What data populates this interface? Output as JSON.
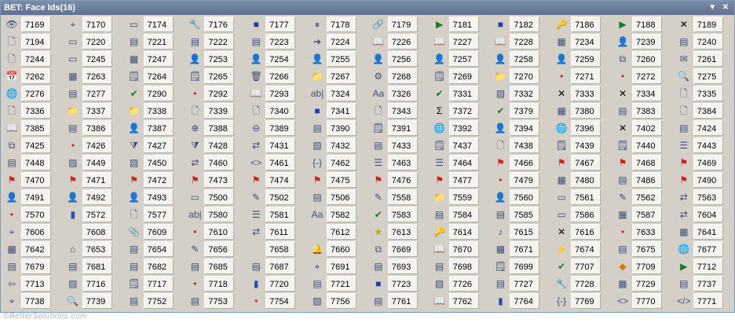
{
  "window": {
    "title": "BET: Face Ids(16)"
  },
  "footer_text": "©BetterSolutions.com",
  "icon_glyphs": {
    "eye": "👁",
    "crop": "⌖",
    "rect": "▭",
    "wrench": "🔧",
    "square": "■",
    "pause": "⏸",
    "link": "🔗",
    "play": "▶",
    "stop": "■",
    "key": "🔑",
    "grid": "▦",
    "xmark": "✕",
    "page": "🗋",
    "form": "▤",
    "book": "📖",
    "arrow": "➔",
    "person": "👤",
    "mail": "✉",
    "table": "▦",
    "cal": "📅",
    "note": "🗒",
    "trash": "🗑",
    "folder": "📁",
    "dot": "•",
    "search": "🔍",
    "globe": "🌐",
    "check": "✔",
    "sigma": "Σ",
    "zoomin": "⊕",
    "zoomout": "⊖",
    "flag": "⚑",
    "bell": "🔔",
    "pencil": "✎",
    "arrows": "⇄",
    "home": "⌂",
    "aa": "Aa",
    "abl": "ab|",
    "sound": "♪",
    "lightning": "⚡",
    "lt": "⇦",
    "code": "<>",
    "endcode": "</>",
    "brace": "{-}",
    "chart": "▮",
    "clip": "📎",
    "star": "★",
    "diamond": "◆",
    "image": "▨",
    "funnel": "⧩",
    "gear": "⚙",
    "lines": "☰",
    "copy": "⧉",
    "x": "✕",
    "blank": " "
  },
  "rows": [
    [
      [
        "eye",
        "7169"
      ],
      [
        "crop",
        "7170"
      ],
      [
        "rect",
        "7174"
      ],
      [
        "wrench",
        "7176"
      ],
      [
        "square",
        "7177"
      ],
      [
        "pause",
        "7178"
      ],
      [
        "link",
        "7179"
      ],
      [
        "play",
        "7181"
      ],
      [
        "stop",
        "7182"
      ],
      [
        "key",
        "7186"
      ],
      [
        "play",
        "7188"
      ],
      [
        "xmark",
        "7189"
      ]
    ],
    [
      [
        "page",
        "7194"
      ],
      [
        "rect",
        "7220"
      ],
      [
        "form",
        "7221"
      ],
      [
        "form",
        "7222"
      ],
      [
        "form",
        "7223"
      ],
      [
        "arrow",
        "7224"
      ],
      [
        "book",
        "7226"
      ],
      [
        "book",
        "7227"
      ],
      [
        "book",
        "7228"
      ],
      [
        "table",
        "7234"
      ],
      [
        "person",
        "7239"
      ],
      [
        "form",
        "7240"
      ]
    ],
    [
      [
        "page",
        "7244"
      ],
      [
        "rect",
        "7245"
      ],
      [
        "table",
        "7247"
      ],
      [
        "person",
        "7253"
      ],
      [
        "person",
        "7254"
      ],
      [
        "person",
        "7255"
      ],
      [
        "person",
        "7256"
      ],
      [
        "person",
        "7257"
      ],
      [
        "person",
        "7258"
      ],
      [
        "person",
        "7259"
      ],
      [
        "copy",
        "7260"
      ],
      [
        "mail",
        "7261"
      ]
    ],
    [
      [
        "cal",
        "7262"
      ],
      [
        "table",
        "7263"
      ],
      [
        "note",
        "7264"
      ],
      [
        "note",
        "7265"
      ],
      [
        "trash",
        "7266"
      ],
      [
        "folder",
        "7267"
      ],
      [
        "gear",
        "7268"
      ],
      [
        "note",
        "7269"
      ],
      [
        "folder",
        "7270"
      ],
      [
        "dot",
        "7271"
      ],
      [
        "dot",
        "7272"
      ],
      [
        "search",
        "7275"
      ]
    ],
    [
      [
        "globe",
        "7276"
      ],
      [
        "form",
        "7277"
      ],
      [
        "check",
        "7290"
      ],
      [
        "dot",
        "7292"
      ],
      [
        "book",
        "7293"
      ],
      [
        "abl",
        "7324"
      ],
      [
        "aa",
        "7326"
      ],
      [
        "check",
        "7331"
      ],
      [
        "image",
        "7332"
      ],
      [
        "x",
        "7333"
      ],
      [
        "x",
        "7334"
      ],
      [
        "page",
        "7335"
      ]
    ],
    [
      [
        "page",
        "7336"
      ],
      [
        "folder",
        "7337"
      ],
      [
        "folder",
        "7338"
      ],
      [
        "page",
        "7339"
      ],
      [
        "page",
        "7340"
      ],
      [
        "square",
        "7341"
      ],
      [
        "page",
        "7343"
      ],
      [
        "sigma",
        "7372"
      ],
      [
        "check",
        "7379"
      ],
      [
        "table",
        "7380"
      ],
      [
        "form",
        "7383"
      ],
      [
        "page",
        "7384"
      ]
    ],
    [
      [
        "book",
        "7385"
      ],
      [
        "form",
        "7386"
      ],
      [
        "person",
        "7387"
      ],
      [
        "zoomin",
        "7388"
      ],
      [
        "zoomout",
        "7389"
      ],
      [
        "form",
        "7390"
      ],
      [
        "note",
        "7391"
      ],
      [
        "globe",
        "7392"
      ],
      [
        "person",
        "7394"
      ],
      [
        "globe",
        "7396"
      ],
      [
        "x",
        "7402"
      ],
      [
        "form",
        "7424"
      ]
    ],
    [
      [
        "copy",
        "7425"
      ],
      [
        "dot",
        "7426"
      ],
      [
        "funnel",
        "7427"
      ],
      [
        "funnel",
        "7428"
      ],
      [
        "arrows",
        "7431"
      ],
      [
        "image",
        "7432"
      ],
      [
        "form",
        "7433"
      ],
      [
        "note",
        "7437"
      ],
      [
        "page",
        "7438"
      ],
      [
        "note",
        "7439"
      ],
      [
        "note",
        "7440"
      ],
      [
        "lines",
        "7443"
      ]
    ],
    [
      [
        "form",
        "7448"
      ],
      [
        "image",
        "7449"
      ],
      [
        "image",
        "7450"
      ],
      [
        "arrows",
        "7460"
      ],
      [
        "code",
        "7461"
      ],
      [
        "brace",
        "7462"
      ],
      [
        "lines",
        "7463"
      ],
      [
        "lines",
        "7464"
      ],
      [
        "flag",
        "7466"
      ],
      [
        "flag",
        "7467"
      ],
      [
        "flag",
        "7468"
      ],
      [
        "flag",
        "7469"
      ]
    ],
    [
      [
        "flag",
        "7470"
      ],
      [
        "flag",
        "7471"
      ],
      [
        "flag",
        "7472"
      ],
      [
        "flag",
        "7473"
      ],
      [
        "flag",
        "7474"
      ],
      [
        "flag",
        "7475"
      ],
      [
        "flag",
        "7476"
      ],
      [
        "flag",
        "7477"
      ],
      [
        "dot",
        "7479"
      ],
      [
        "table",
        "7480"
      ],
      [
        "form",
        "7486"
      ],
      [
        "flag",
        "7490"
      ]
    ],
    [
      [
        "person",
        "7491"
      ],
      [
        "person",
        "7492"
      ],
      [
        "person",
        "7493"
      ],
      [
        "rect",
        "7500"
      ],
      [
        "pencil",
        "7502"
      ],
      [
        "form",
        "7506"
      ],
      [
        "pencil",
        "7558"
      ],
      [
        "folder",
        "7559"
      ],
      [
        "person",
        "7560"
      ],
      [
        "rect",
        "7561"
      ],
      [
        "pencil",
        "7562"
      ],
      [
        "arrows",
        "7563"
      ]
    ],
    [
      [
        "dot",
        "7570"
      ],
      [
        "chart",
        "7572"
      ],
      [
        "page",
        "7577"
      ],
      [
        "abl",
        "7580"
      ],
      [
        "lines",
        "7581"
      ],
      [
        "aa",
        "7582"
      ],
      [
        "check",
        "7583"
      ],
      [
        "form",
        "7584"
      ],
      [
        "form",
        "7585"
      ],
      [
        "rect",
        "7586"
      ],
      [
        "table",
        "7587"
      ],
      [
        "arrows",
        "7604"
      ]
    ],
    [
      [
        "crop",
        "7606"
      ],
      [
        "blank",
        "7608"
      ],
      [
        "clip",
        "7609"
      ],
      [
        "dot",
        "7610"
      ],
      [
        "arrows",
        "7611"
      ],
      [
        "blank",
        "7612"
      ],
      [
        "star",
        "7613"
      ],
      [
        "key",
        "7614"
      ],
      [
        "sound",
        "7615"
      ],
      [
        "x",
        "7616"
      ],
      [
        "dot",
        "7633"
      ],
      [
        "table",
        "7641"
      ]
    ],
    [
      [
        "table",
        "7642"
      ],
      [
        "home",
        "7653"
      ],
      [
        "form",
        "7654"
      ],
      [
        "pencil",
        "7656"
      ],
      [
        "blank",
        "7658"
      ],
      [
        "bell",
        "7660"
      ],
      [
        "copy",
        "7669"
      ],
      [
        "book",
        "7670"
      ],
      [
        "table",
        "7671"
      ],
      [
        "lightning",
        "7674"
      ],
      [
        "form",
        "7675"
      ],
      [
        "globe",
        "7677"
      ]
    ],
    [
      [
        "form",
        "7679"
      ],
      [
        "form",
        "7681"
      ],
      [
        "form",
        "7682"
      ],
      [
        "form",
        "7685"
      ],
      [
        "form",
        "7687"
      ],
      [
        "crop",
        "7691"
      ],
      [
        "form",
        "7693"
      ],
      [
        "form",
        "7698"
      ],
      [
        "note",
        "7699"
      ],
      [
        "check",
        "7707"
      ],
      [
        "diamond",
        "7709"
      ],
      [
        "play",
        "7712"
      ]
    ],
    [
      [
        "lt",
        "7713"
      ],
      [
        "image",
        "7716"
      ],
      [
        "note",
        "7717"
      ],
      [
        "dot",
        "7718"
      ],
      [
        "chart",
        "7720"
      ],
      [
        "form",
        "7721"
      ],
      [
        "stop",
        "7723"
      ],
      [
        "image",
        "7726"
      ],
      [
        "form",
        "7727"
      ],
      [
        "wrench",
        "7728"
      ],
      [
        "table",
        "7729"
      ],
      [
        "form",
        "7737"
      ]
    ],
    [
      [
        "crop",
        "7738"
      ],
      [
        "search",
        "7739"
      ],
      [
        "form",
        "7752"
      ],
      [
        "form",
        "7753"
      ],
      [
        "dot",
        "7754"
      ],
      [
        "image",
        "7756"
      ],
      [
        "form",
        "7761"
      ],
      [
        "book",
        "7762"
      ],
      [
        "chart",
        "7764"
      ],
      [
        "brace",
        "7769"
      ],
      [
        "code",
        "7770"
      ],
      [
        "endcode",
        "7771"
      ]
    ]
  ]
}
